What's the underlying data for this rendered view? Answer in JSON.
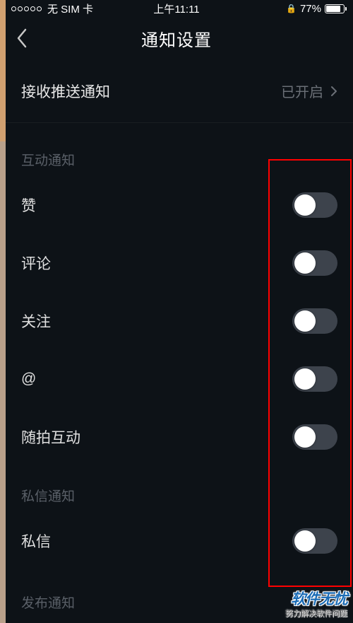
{
  "status": {
    "carrier": "无 SIM 卡",
    "time": "上午11:11",
    "battery_pct": "77%"
  },
  "nav": {
    "title": "通知设置"
  },
  "push": {
    "label": "接收推送通知",
    "value": "已开启"
  },
  "sections": {
    "interactive": {
      "header": "互动通知",
      "items": [
        {
          "label": "赞",
          "on": false
        },
        {
          "label": "评论",
          "on": false
        },
        {
          "label": "关注",
          "on": false
        },
        {
          "label": "@",
          "on": false
        },
        {
          "label": "随拍互动",
          "on": false
        }
      ]
    },
    "dm": {
      "header": "私信通知",
      "items": [
        {
          "label": "私信",
          "on": false
        }
      ]
    },
    "publish": {
      "header": "发布通知"
    }
  },
  "watermark": {
    "main": "软件无忧",
    "sub": "努力解决软件问题"
  }
}
